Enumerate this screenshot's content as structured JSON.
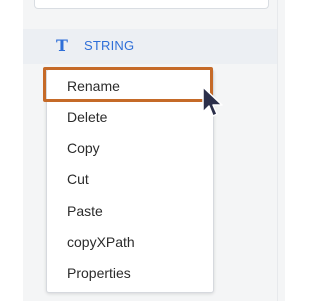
{
  "tree": {
    "node": {
      "icon": "text-type-icon",
      "icon_glyph": "T",
      "label": "STRING"
    }
  },
  "context_menu": {
    "items": [
      {
        "label": "Rename"
      },
      {
        "label": "Delete"
      },
      {
        "label": "Copy"
      },
      {
        "label": "Cut"
      },
      {
        "label": "Paste"
      },
      {
        "label": "copyXPath"
      },
      {
        "label": "Properties"
      }
    ],
    "highlighted": "Rename"
  },
  "colors": {
    "accent": "#2f6fd8",
    "highlight": "#c56a28",
    "cursor": "#2b2f4a"
  },
  "icons": {
    "cursor": "mouse-pointer-icon"
  }
}
